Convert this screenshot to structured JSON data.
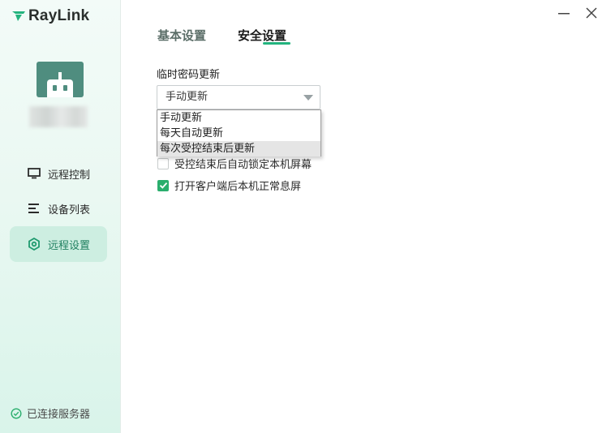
{
  "app": {
    "name": "RayLink"
  },
  "colors": {
    "accent": "#23b37e",
    "active_bg": "#cdeee1",
    "avatar_bg": "#4f8d7f"
  },
  "sidebar": {
    "items": [
      {
        "label": "远程控制",
        "icon": "monitor-icon"
      },
      {
        "label": "设备列表",
        "icon": "list-icon"
      },
      {
        "label": "远程设置",
        "icon": "hexagon-settings-icon",
        "active": true
      }
    ],
    "status": "已连接服务器"
  },
  "tabs": [
    {
      "label": "基本设置"
    },
    {
      "label": "安全设置",
      "active": true
    }
  ],
  "security": {
    "temp_password_label": "临时密码更新",
    "select_value": "手动更新",
    "options": [
      "手动更新",
      "每天自动更新",
      "每次受控结束后更新"
    ],
    "checkboxes": [
      {
        "label": "受控结束后自动锁定本机屏幕",
        "checked": false
      },
      {
        "label": "打开客户端后本机正常息屏",
        "checked": true
      }
    ]
  }
}
